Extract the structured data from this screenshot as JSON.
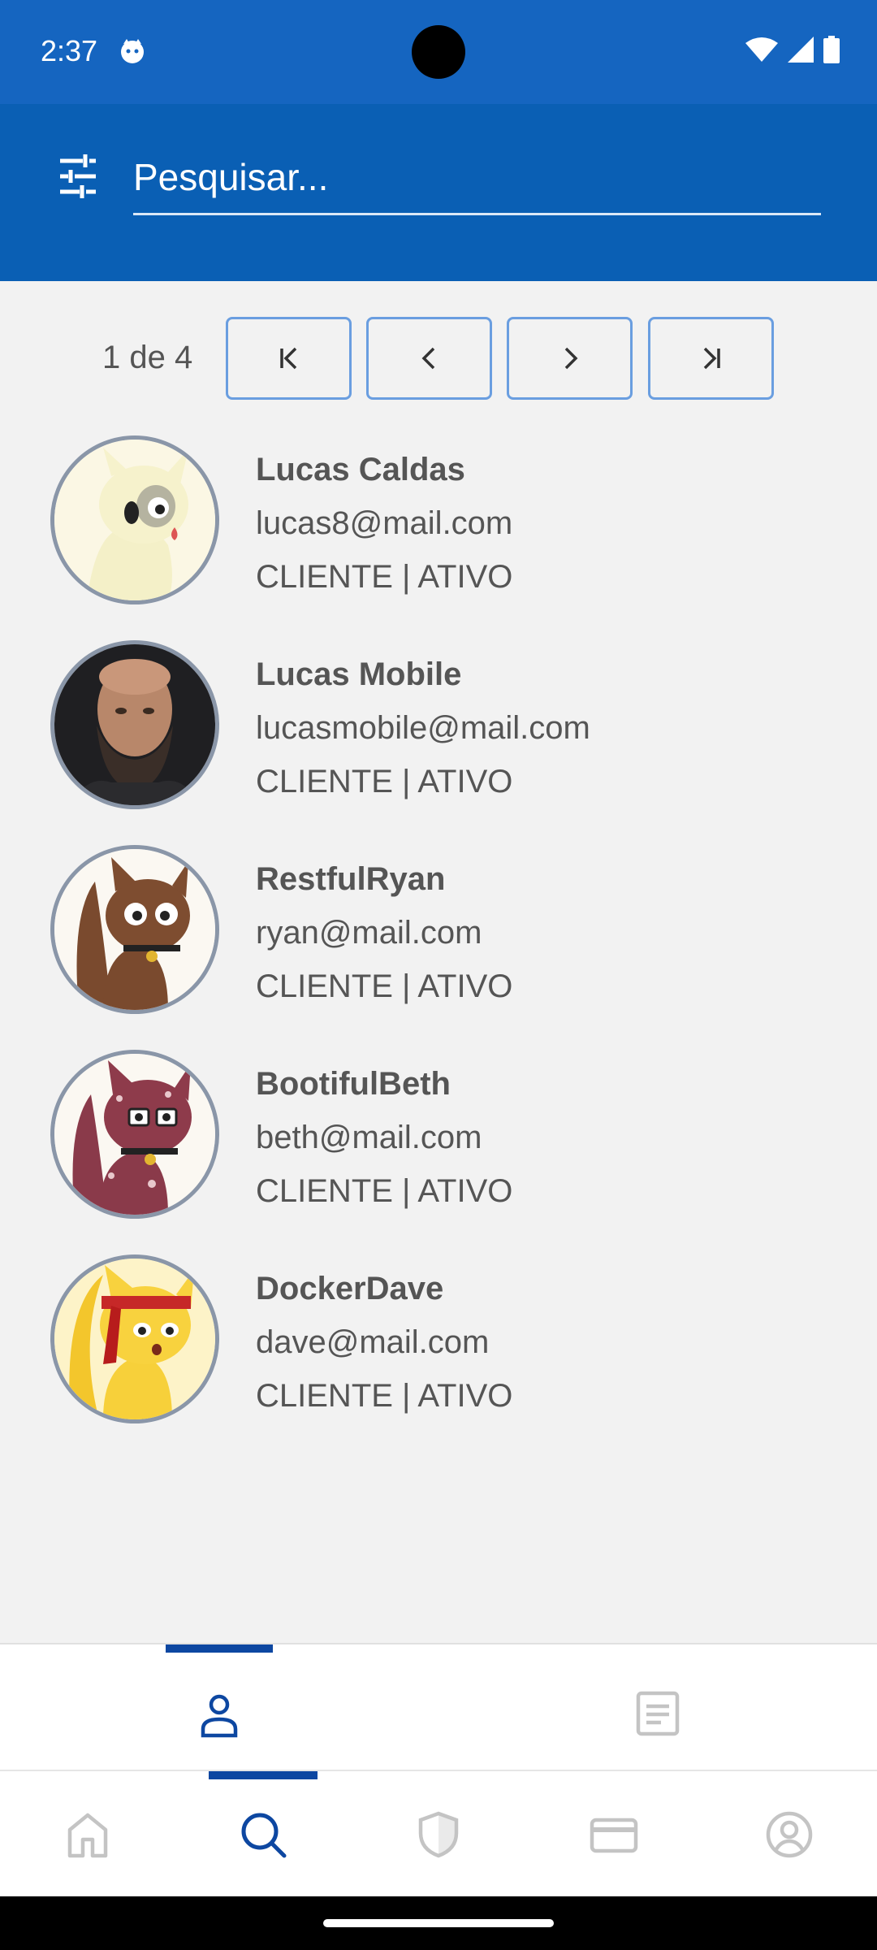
{
  "status_bar": {
    "time": "2:37"
  },
  "search": {
    "placeholder": "Pesquisar...",
    "value": ""
  },
  "pagination": {
    "indicator": "1 de 4",
    "buttons": [
      "first-page",
      "previous-page",
      "next-page",
      "last-page"
    ]
  },
  "users": [
    {
      "name": "Lucas Caldas",
      "email": "lucas8@mail.com",
      "status": "CLIENTE | ATIVO"
    },
    {
      "name": "Lucas Mobile",
      "email": "lucasmobile@mail.com",
      "status": "CLIENTE | ATIVO"
    },
    {
      "name": "RestfulRyan",
      "email": "ryan@mail.com",
      "status": "CLIENTE | ATIVO"
    },
    {
      "name": "BootifulBeth",
      "email": "beth@mail.com",
      "status": "CLIENTE | ATIVO"
    },
    {
      "name": "DockerDave",
      "email": "dave@mail.com",
      "status": "CLIENTE | ATIVO"
    }
  ],
  "sub_tabs": [
    {
      "icon": "person-icon",
      "active": true
    },
    {
      "icon": "document-icon",
      "active": false
    }
  ],
  "bottom_nav": [
    {
      "icon": "home-icon",
      "active": false
    },
    {
      "icon": "search-icon",
      "active": true
    },
    {
      "icon": "shield-icon",
      "active": false
    },
    {
      "icon": "card-icon",
      "active": false
    },
    {
      "icon": "account-icon",
      "active": false
    }
  ],
  "colors": {
    "status_bar": "#1565c0",
    "header": "#0a5fb4",
    "accent": "#0d47a1",
    "background": "#f2f2f2",
    "inactive_icon": "#c4c4c4"
  }
}
